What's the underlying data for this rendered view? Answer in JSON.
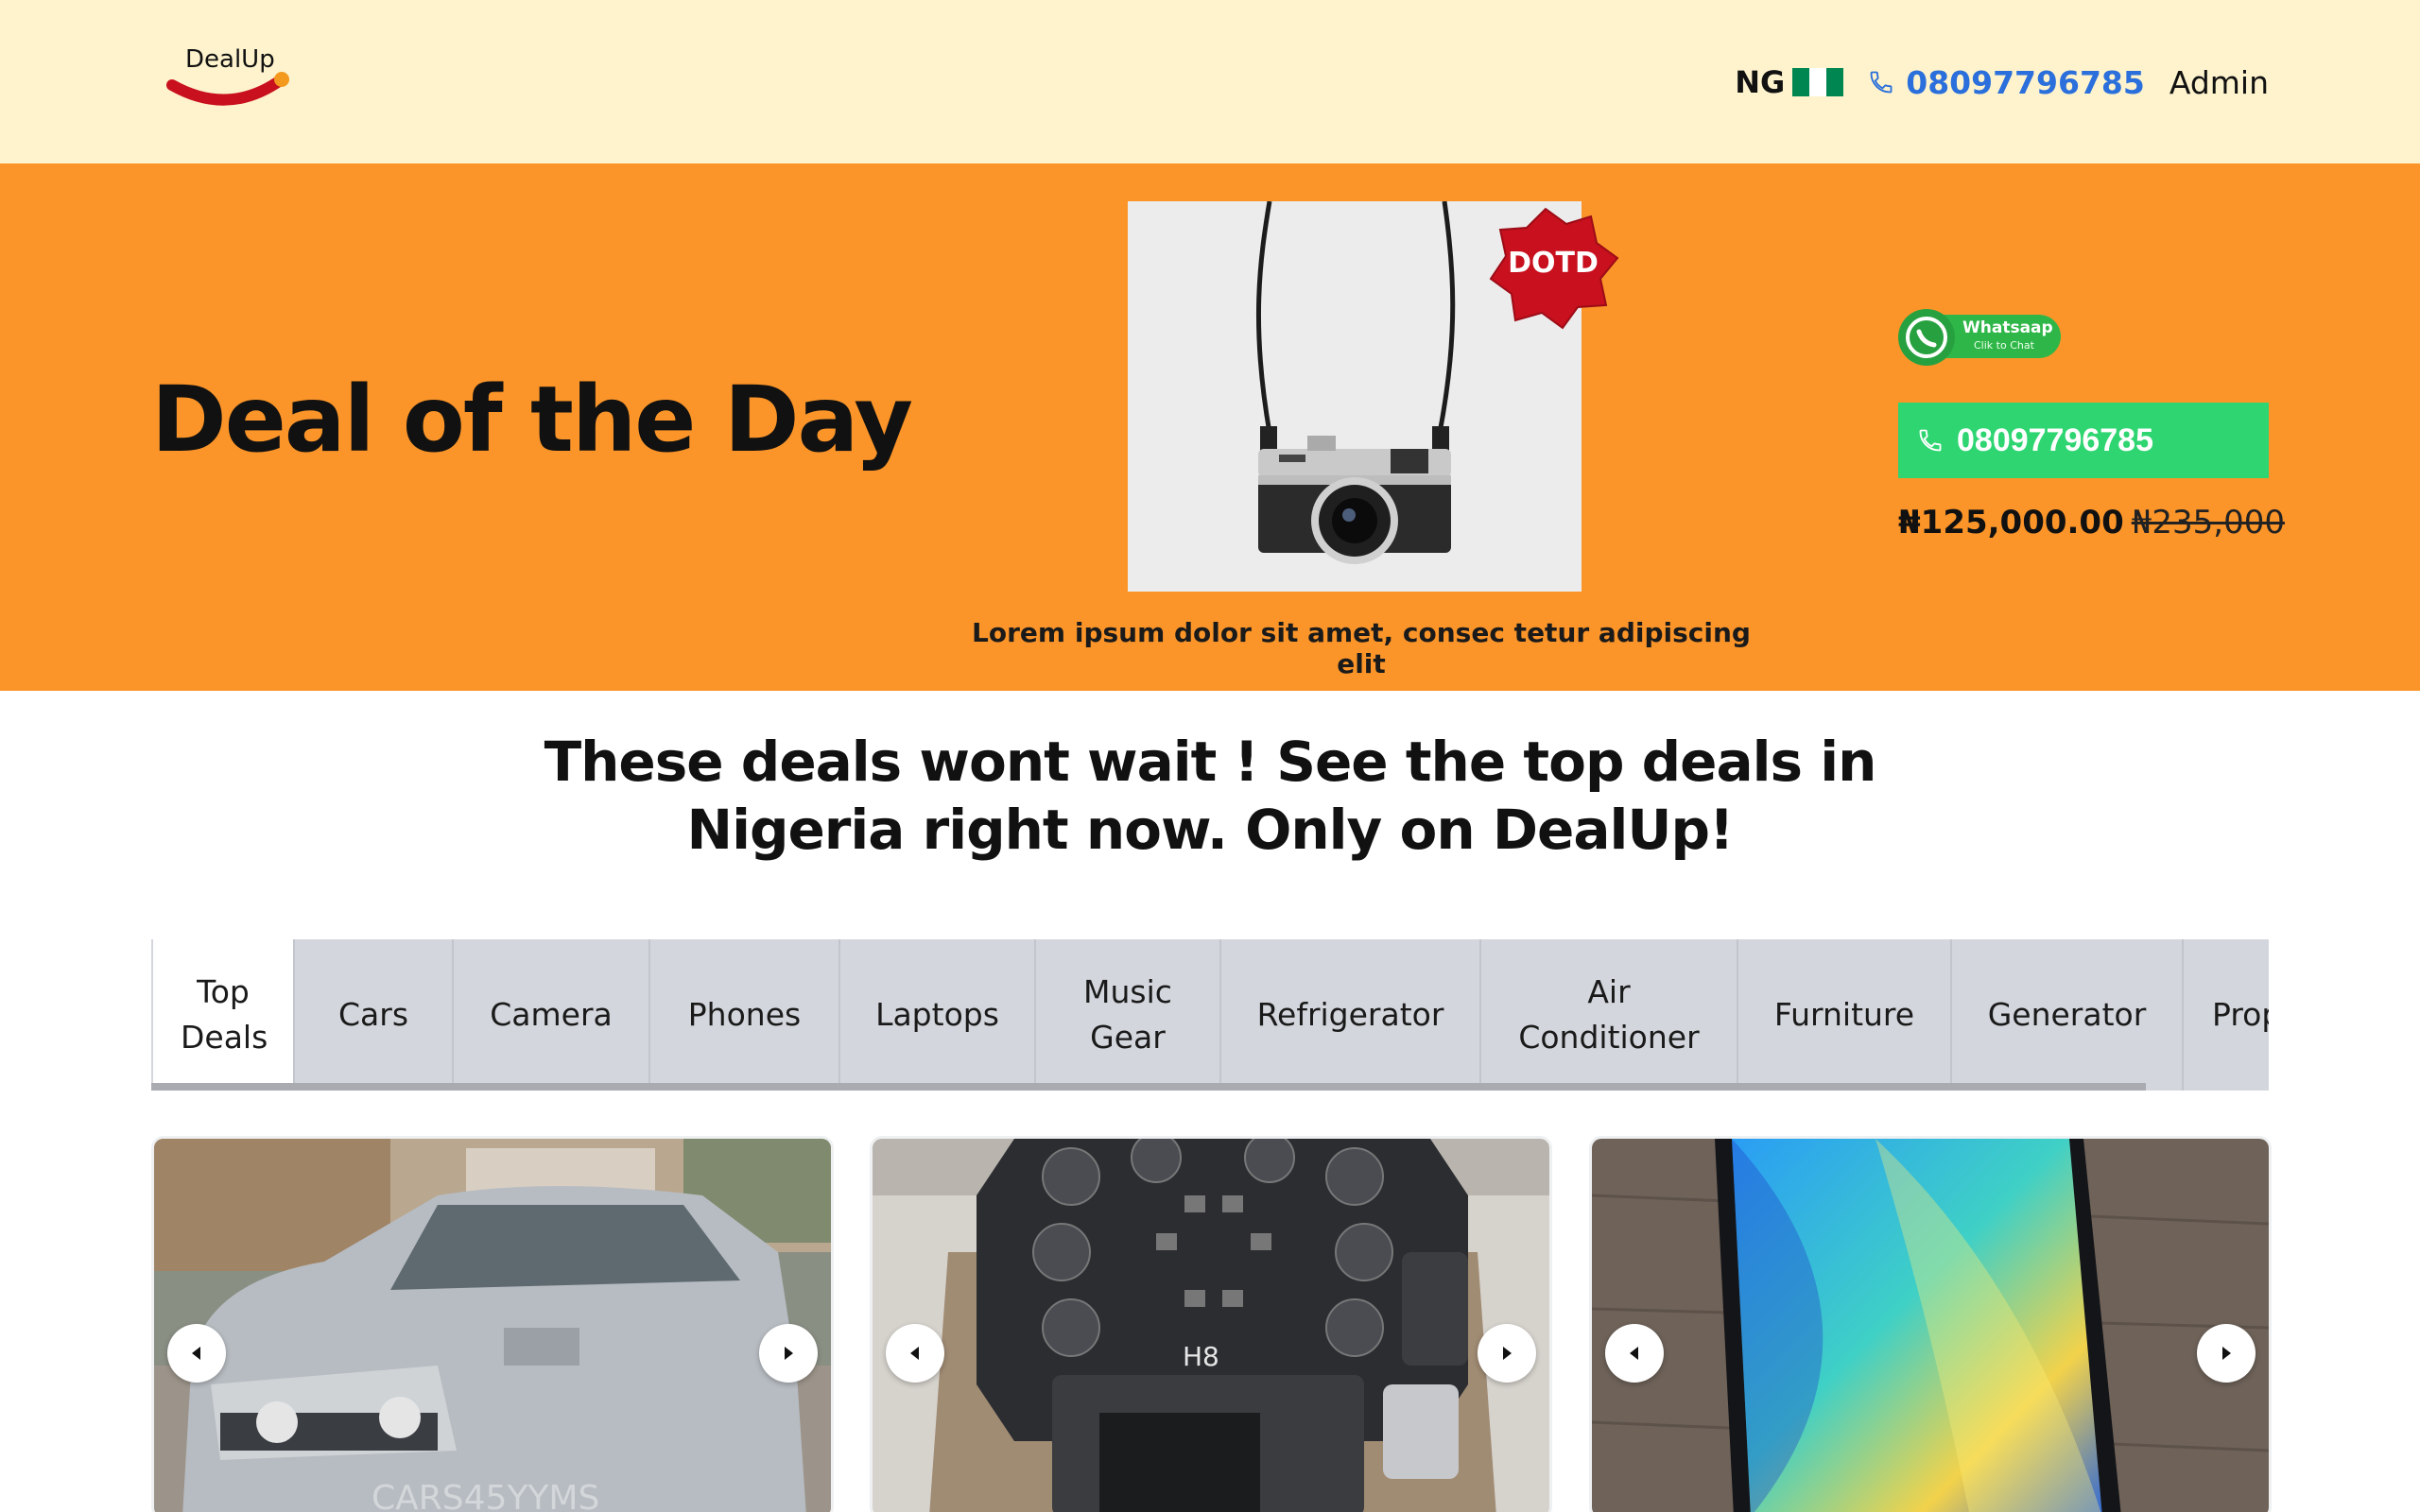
{
  "header": {
    "logo_text": "DealUp",
    "country_code": "NG",
    "flag_colors": [
      "#008751",
      "#ffffff",
      "#008751"
    ],
    "phone": "08097796785",
    "admin_label": "Admin",
    "phone_icon": "phone-icon"
  },
  "hero": {
    "title": "Deal of the Day",
    "badge": "DOTD",
    "caption": "Lorem ipsum dolor sit amet, consec tetur adipiscing elit",
    "whatsapp_title": "Whatsaap",
    "whatsapp_subtitle": "Clik to Chat",
    "call_phone": "08097796785",
    "price_now": "₦125,000.00",
    "price_old": "₦235,000",
    "colors": {
      "background": "#fb9529",
      "call_button": "#2ed571",
      "badge": "#c8101e"
    }
  },
  "tagline": {
    "line1": "These deals wont wait ! See the top deals in",
    "line2": "Nigeria right now. Only on DealUp!"
  },
  "tabs": [
    {
      "label": "Top Deals",
      "active": true
    },
    {
      "label": "Cars"
    },
    {
      "label": "Camera"
    },
    {
      "label": "Phones"
    },
    {
      "label": "Laptops"
    },
    {
      "label": "Music Gear"
    },
    {
      "label": "Refrigerator"
    },
    {
      "label": "Air Conditioner"
    },
    {
      "label": "Furniture"
    },
    {
      "label": "Generator"
    },
    {
      "label": "Prop"
    }
  ],
  "cards": [
    {
      "image": "silver-suv-photo",
      "watermark": "CARS45YYMS"
    },
    {
      "image": "audio-recorder-photo",
      "device_label": "H8"
    },
    {
      "image": "smartphone-photo"
    }
  ]
}
